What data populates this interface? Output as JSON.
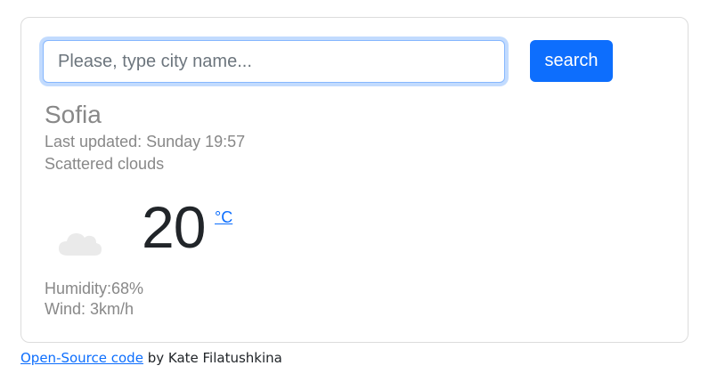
{
  "search": {
    "placeholder": "Please, type city name...",
    "value": "",
    "button_label": "search"
  },
  "weather": {
    "city": "Sofia",
    "last_updated": "Last updated: Sunday 19:57",
    "description": "Scattered clouds",
    "icon": "cloud-icon",
    "temperature": "20",
    "unit": "°C",
    "humidity_label": "Humidity:",
    "humidity_value": "68%",
    "wind": "Wind: 3km/h"
  },
  "footer": {
    "link_text": "Open-Source code",
    "author_text": " by Kate Filatushkina"
  },
  "colors": {
    "accent": "#0d6efd",
    "muted_text": "#888888",
    "icon": "#eaeaea"
  }
}
